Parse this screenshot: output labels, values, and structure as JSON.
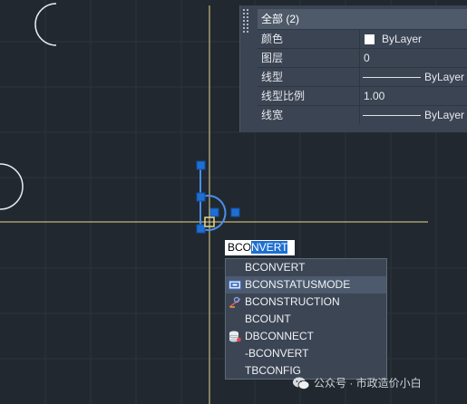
{
  "properties": {
    "title": "全部 (2)",
    "rows": [
      {
        "key": "颜色",
        "value": "ByLayer"
      },
      {
        "key": "图层",
        "value": "0"
      },
      {
        "key": "线型",
        "value": "ByLayer"
      },
      {
        "key": "线型比例",
        "value": "1.00"
      },
      {
        "key": "线宽",
        "value": "ByLayer"
      }
    ]
  },
  "command": {
    "typed": "BCO",
    "autocomplete": "NVERT"
  },
  "suggestions": [
    {
      "label": "BCONVERT",
      "icon": "none"
    },
    {
      "label": "BCONSTATUSMODE",
      "icon": "status-mode-icon"
    },
    {
      "label": "BCONSTRUCTION",
      "icon": "construction-icon"
    },
    {
      "label": "BCOUNT",
      "icon": "none"
    },
    {
      "label": "DBCONNECT",
      "icon": "database-icon"
    },
    {
      "label": "-BCONVERT",
      "icon": "none"
    },
    {
      "label": "TBCONFIG",
      "icon": "none"
    }
  ],
  "watermark": {
    "text": "公众号 · 市政造价小白"
  },
  "colors": {
    "background": "#212830",
    "grid": "#2c333c",
    "crosshair": "#e8d78a",
    "geometry": "#e8ecf0",
    "selected": "#4a8fe8",
    "grip": "#1f6fd1"
  }
}
